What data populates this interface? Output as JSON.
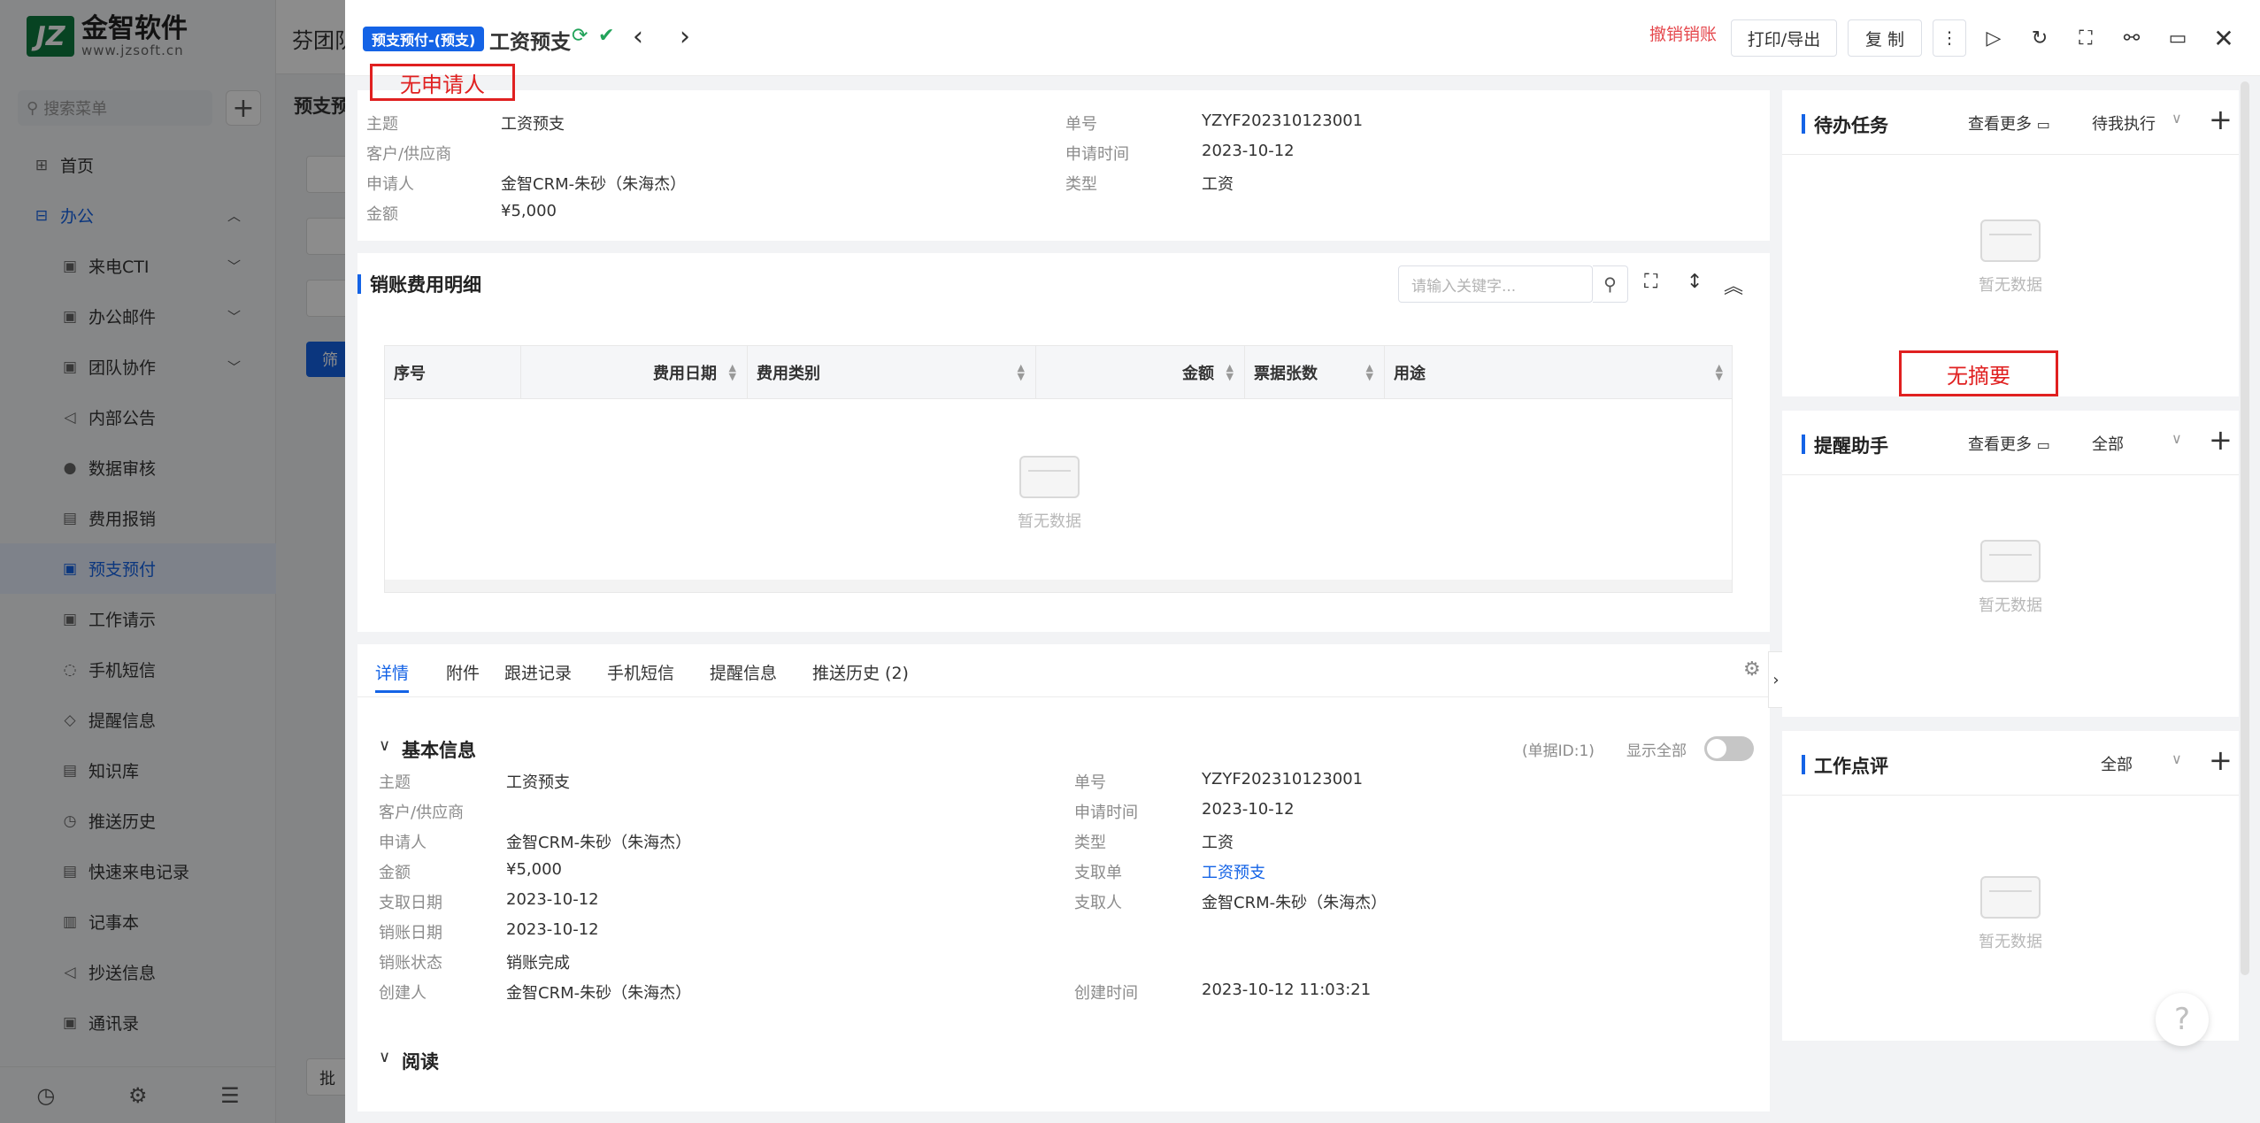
{
  "app": {
    "logo_mark": "JZ",
    "logo_name": "金智软件",
    "logo_url": "www.jzsoft.cn",
    "search_placeholder": "搜索菜单",
    "bg_tab": "芬团队",
    "bg_subtitle": "预支预",
    "bg_filter_btn": "筛",
    "bg_batch_btn": "批"
  },
  "nav": [
    {
      "label": "首页",
      "icon": "home-icon"
    },
    {
      "label": "办公",
      "icon": "office-icon"
    },
    {
      "label": "来电CTI",
      "icon": "cti-icon"
    },
    {
      "label": "办公邮件",
      "icon": "mail-icon"
    },
    {
      "label": "团队协作",
      "icon": "team-icon"
    },
    {
      "label": "内部公告",
      "icon": "notice-icon"
    },
    {
      "label": "数据审核",
      "icon": "audit-icon"
    },
    {
      "label": "费用报销",
      "icon": "expense-icon"
    },
    {
      "label": "预支预付",
      "icon": "prepay-icon"
    },
    {
      "label": "工作请示",
      "icon": "request-icon"
    },
    {
      "label": "手机短信",
      "icon": "sms-icon"
    },
    {
      "label": "提醒信息",
      "icon": "bell-icon"
    },
    {
      "label": "知识库",
      "icon": "book-icon"
    },
    {
      "label": "推送历史",
      "icon": "history-icon"
    },
    {
      "label": "快速来电记录",
      "icon": "call-log-icon"
    },
    {
      "label": "记事本",
      "icon": "notebook-icon"
    },
    {
      "label": "抄送信息",
      "icon": "send-icon"
    },
    {
      "label": "通讯录",
      "icon": "contacts-icon"
    }
  ],
  "header": {
    "tag": "预支预付-(预支)",
    "title": "工资预支",
    "cancel_link": "撤销销账",
    "print_btn": "打印/导出",
    "copy_btn": "复 制"
  },
  "annotations": {
    "no_applicant": "无申请人",
    "no_summary": "无摘要"
  },
  "summary": {
    "left": [
      {
        "label": "主题",
        "value": "工资预支"
      },
      {
        "label": "客户/供应商",
        "value": ""
      },
      {
        "label": "申请人",
        "value": "金智CRM-朱砂（朱海杰）"
      },
      {
        "label": "金额",
        "value": "¥5,000"
      }
    ],
    "right": [
      {
        "label": "单号",
        "value": "YZYF202310123001"
      },
      {
        "label": "申请时间",
        "value": "2023-10-12"
      },
      {
        "label": "类型",
        "value": "工资"
      }
    ]
  },
  "detail_table": {
    "title": "销账费用明细",
    "search_placeholder": "请输入关键字...",
    "columns": [
      "序号",
      "费用日期",
      "费用类别",
      "金额",
      "票据张数",
      "用途"
    ],
    "empty_text": "暂无数据"
  },
  "tabs": [
    "详情",
    "附件",
    "跟进记录",
    "手机短信",
    "提醒信息",
    "推送历史 (2)"
  ],
  "basic_info": {
    "title": "基本信息",
    "doc_id": "(单据ID:1)",
    "show_all": "显示全部",
    "left": [
      {
        "label": "主题",
        "value": "工资预支"
      },
      {
        "label": "客户/供应商",
        "value": ""
      },
      {
        "label": "申请人",
        "value": "金智CRM-朱砂（朱海杰）"
      },
      {
        "label": "金额",
        "value": "¥5,000"
      },
      {
        "label": "支取日期",
        "value": "2023-10-12"
      },
      {
        "label": "销账日期",
        "value": "2023-10-12"
      },
      {
        "label": "销账状态",
        "value": "销账完成"
      },
      {
        "label": "创建人",
        "value": "金智CRM-朱砂（朱海杰）"
      }
    ],
    "right": [
      {
        "label": "单号",
        "value": "YZYF202310123001"
      },
      {
        "label": "申请时间",
        "value": "2023-10-12"
      },
      {
        "label": "类型",
        "value": "工资"
      },
      {
        "label": "支取单",
        "value": "工资预支"
      },
      {
        "label": "支取人",
        "value": "金智CRM-朱砂（朱海杰）"
      },
      {
        "label": "创建时间",
        "value": "2023-10-12 11:03:21"
      }
    ],
    "read_title": "阅读"
  },
  "right_panel": [
    {
      "title": "待办任务",
      "more": "查看更多",
      "select": "待我执行",
      "empty": "暂无数据"
    },
    {
      "title": "提醒助手",
      "more": "查看更多",
      "select": "全部",
      "empty": "暂无数据"
    },
    {
      "title": "工作点评",
      "more": "",
      "select": "全部",
      "empty": "暂无数据"
    }
  ],
  "help_glyph": "?"
}
